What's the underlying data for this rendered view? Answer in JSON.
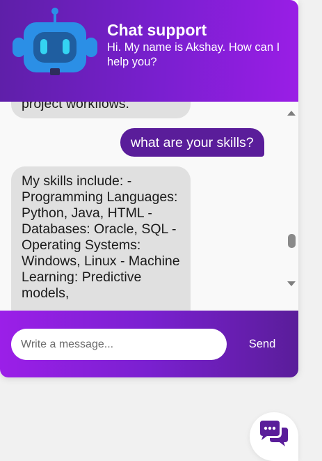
{
  "header": {
    "title": "Chat support",
    "subtitle": "Hi. My name is Akshay. How can I help you?",
    "avatar_icon": "robot-icon"
  },
  "messages": [
    {
      "from": "bot",
      "text": "project workflows."
    },
    {
      "from": "user",
      "text": "what are your skills?"
    },
    {
      "from": "bot",
      "text": "My skills include: - Programming Languages: Python, Java, HTML - Databases: Oracle, SQL - Operating Systems: Windows, Linux - Machine Learning: Predictive models,"
    }
  ],
  "composer": {
    "placeholder": "Write a message...",
    "send_label": "Send"
  },
  "toggle": {
    "icon": "chat-bubbles-icon"
  },
  "colors": {
    "accent_dark": "#5a1d9a",
    "accent_light": "#9b1fe8",
    "bot_bubble": "#e0e0e0",
    "robot_blue": "#2b8fe6"
  }
}
